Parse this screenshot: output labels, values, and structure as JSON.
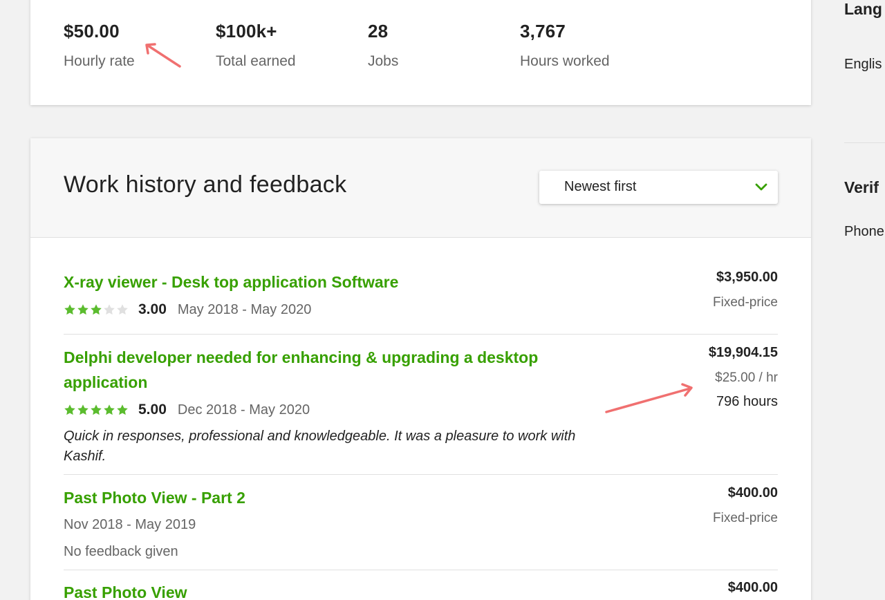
{
  "stats": {
    "hourly_rate": {
      "value": "$50.00",
      "label": "Hourly rate"
    },
    "total_earned": {
      "value": "$100k+",
      "label": "Total earned"
    },
    "jobs": {
      "value": "28",
      "label": "Jobs"
    },
    "hours_worked": {
      "value": "3,767",
      "label": "Hours worked"
    }
  },
  "sidebar": {
    "languages_heading": "Lang",
    "language_item": "Englis",
    "verifications_heading": "Verif",
    "phone_item": "Phone"
  },
  "work_history": {
    "title": "Work history and feedback",
    "sort": {
      "selected": "Newest first",
      "icon": "chevron-down-icon"
    },
    "jobs": [
      {
        "title": "X-ray viewer - Desk top application Software",
        "rating": "3.00",
        "stars_filled": 3,
        "dates": "May 2018 - May 2020",
        "amount": "$3,950.00",
        "price_type": "Fixed-price"
      },
      {
        "title": "Delphi developer needed for enhancing & upgrading a desktop application",
        "rating": "5.00",
        "stars_filled": 5,
        "dates": "Dec 2018 - May 2020",
        "feedback": "Quick in responses, professional and knowledgeable. It was a pleasure to work with Kashif.",
        "amount": "$19,904.15",
        "price_type": "$25.00 / hr",
        "hours": "796 hours"
      },
      {
        "title": "Past Photo View - Part 2",
        "dates": "Nov 2018 - May 2019",
        "feedback_status": "No feedback given",
        "amount": "$400.00",
        "price_type": "Fixed-price"
      },
      {
        "title": "Past Photo View",
        "amount": "$400.00"
      }
    ]
  },
  "colors": {
    "accent_green": "#37a000",
    "star_filled": "#5bbc2e",
    "star_empty": "#e0e0e0",
    "annotation_arrow": "#f07070"
  }
}
